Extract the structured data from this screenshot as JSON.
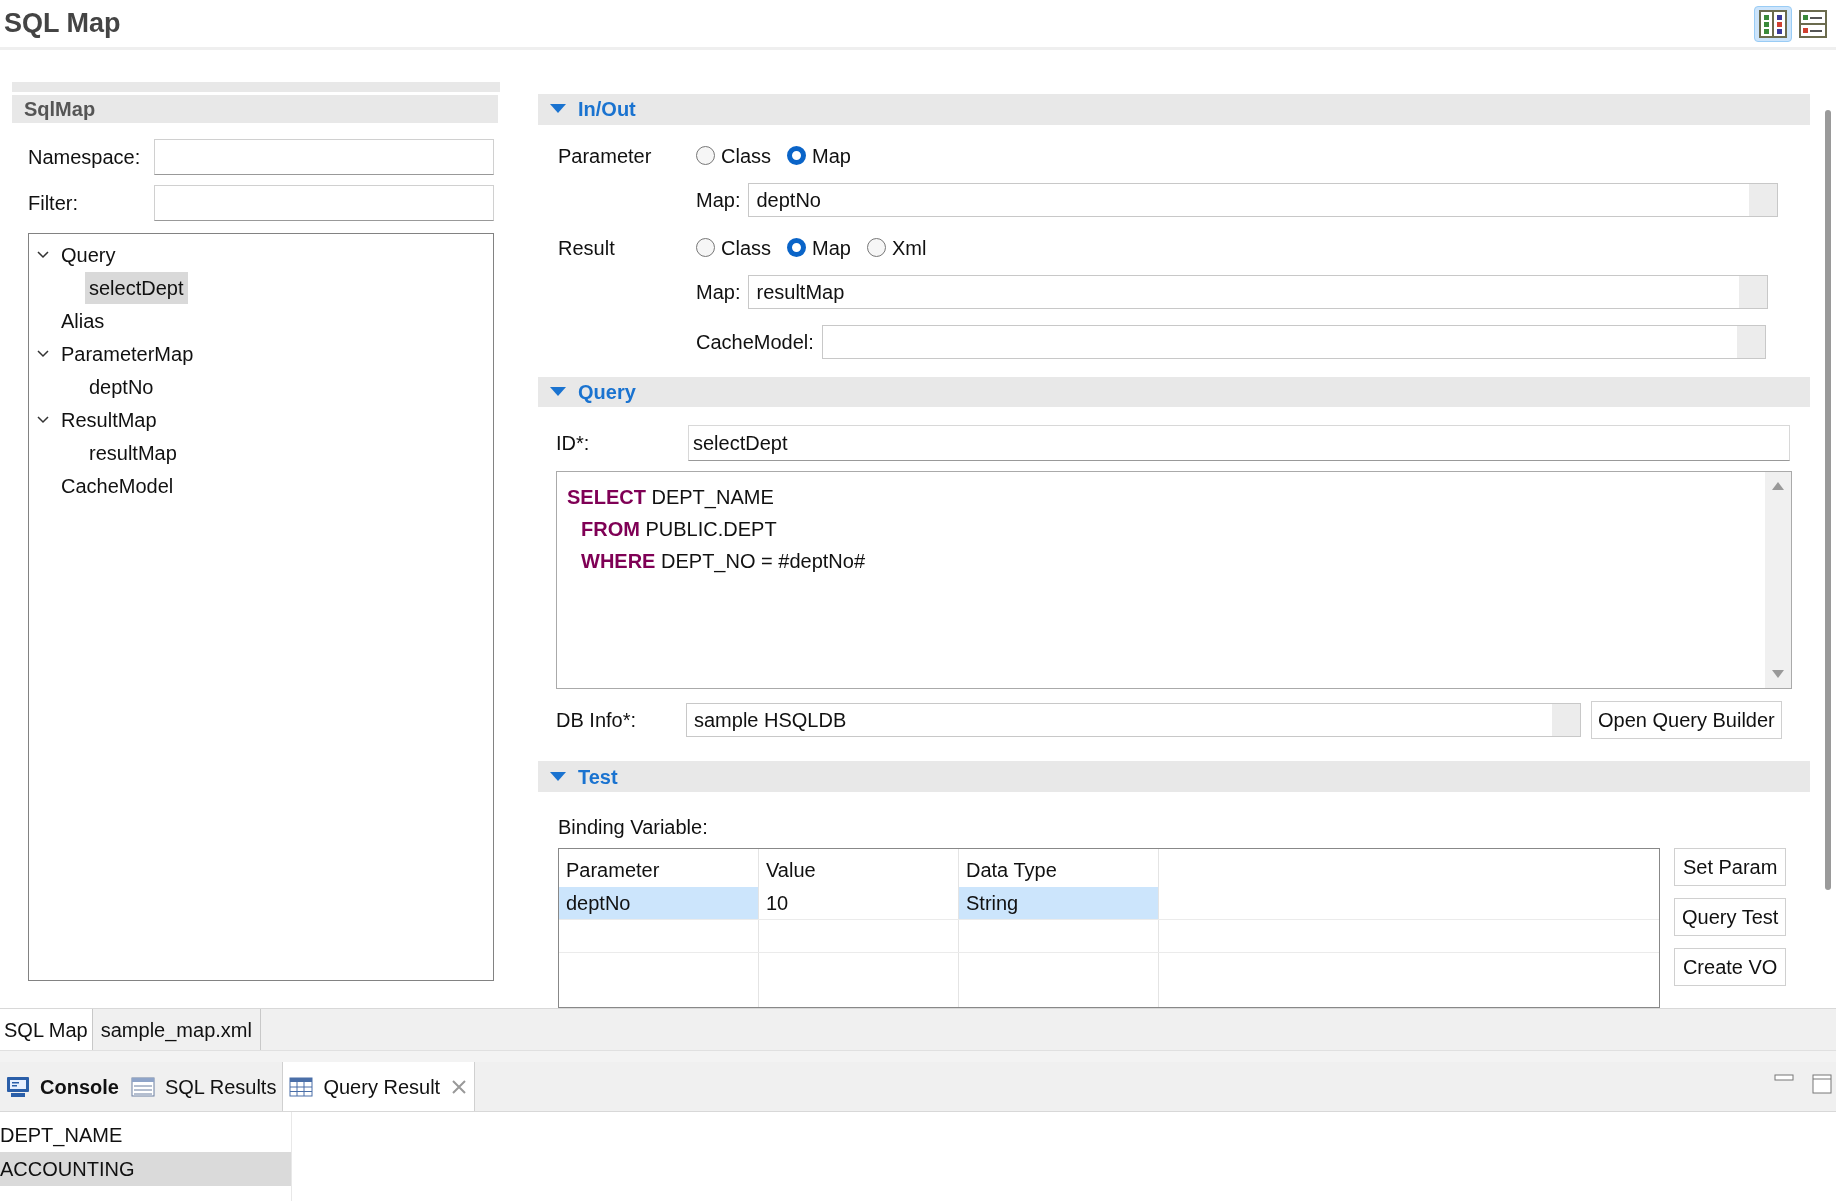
{
  "title": "SQL Map",
  "view_toggles": [
    {
      "kind": "columns",
      "selected": true
    },
    {
      "kind": "rows",
      "selected": false
    }
  ],
  "sqlmap_panel": {
    "title": "SqlMap",
    "fields": [
      {
        "label": "Namespace:"
      },
      {
        "label": "Filter:"
      }
    ],
    "tree": [
      {
        "label": "Query",
        "expanded": true,
        "selected": false,
        "children": [
          {
            "label": "selectDept",
            "selected": true
          }
        ]
      },
      {
        "label": "Alias",
        "selected": false
      },
      {
        "label": "ParameterMap",
        "expanded": true,
        "selected": false,
        "children": [
          {
            "label": "deptNo",
            "selected": false
          }
        ]
      },
      {
        "label": "ResultMap",
        "expanded": true,
        "selected": false,
        "children": [
          {
            "label": "resultMap",
            "selected": false
          }
        ]
      },
      {
        "label": "CacheModel",
        "selected": false
      }
    ]
  },
  "in_out": {
    "title": "In/Out",
    "expanded": true,
    "parameter": {
      "label": "Parameter",
      "options": [
        {
          "label": "Class",
          "selected": false
        },
        {
          "label": "Map",
          "selected": true
        }
      ],
      "map_label": "Map:",
      "map_value": "deptNo"
    },
    "result": {
      "label": "Result",
      "options": [
        {
          "label": "Class",
          "selected": false
        },
        {
          "label": "Map",
          "selected": true
        },
        {
          "label": "Xml",
          "selected": false
        }
      ],
      "map_label": "Map:",
      "map_value": "resultMap",
      "cache_label": "CacheModel:"
    }
  },
  "query": {
    "title": "Query",
    "expanded": true,
    "id_label": "ID*:",
    "id_value": "selectDept",
    "sql": [
      {
        "keyword": "SELECT",
        "rest": "DEPT_NAME",
        "indented": false
      },
      {
        "keyword": "FROM",
        "rest": "PUBLIC.DEPT",
        "indented": true
      },
      {
        "keyword": "WHERE",
        "rest": "DEPT_NO = #deptNo#",
        "indented": true
      }
    ],
    "db_label": "DB Info*:",
    "db_value": "sample HSQLDB",
    "builder_button": "Open Query Builder"
  },
  "test": {
    "title": "Test",
    "expanded": true,
    "binding_label": "Binding Variable:",
    "columns": [
      "Parameter",
      "Value",
      "Data Type"
    ],
    "rows": [
      {
        "cells": [
          {
            "text": "deptNo",
            "highlighted": true
          },
          {
            "text": "10",
            "highlighted": false
          },
          {
            "text": "String",
            "highlighted": true
          }
        ]
      }
    ],
    "buttons": [
      "Set Param",
      "Query Test",
      "Create VO"
    ]
  },
  "editor_tabs": [
    {
      "label": "SQL Map",
      "selected": true
    },
    {
      "label": "sample_map.xml",
      "selected": false
    }
  ],
  "view_tabs": [
    {
      "kind": "console",
      "label": "Console",
      "selected": false,
      "bold": true,
      "closable": false
    },
    {
      "kind": "results",
      "label": "SQL Results",
      "selected": false,
      "bold": false,
      "closable": false
    },
    {
      "kind": "grid",
      "label": "Query Result",
      "selected": true,
      "bold": false,
      "closable": true
    }
  ],
  "result_grid": {
    "columns": [
      "DEPT_NAME"
    ],
    "rows": [
      {
        "cells": [
          "ACCOUNTING"
        ],
        "selected": true
      }
    ]
  }
}
